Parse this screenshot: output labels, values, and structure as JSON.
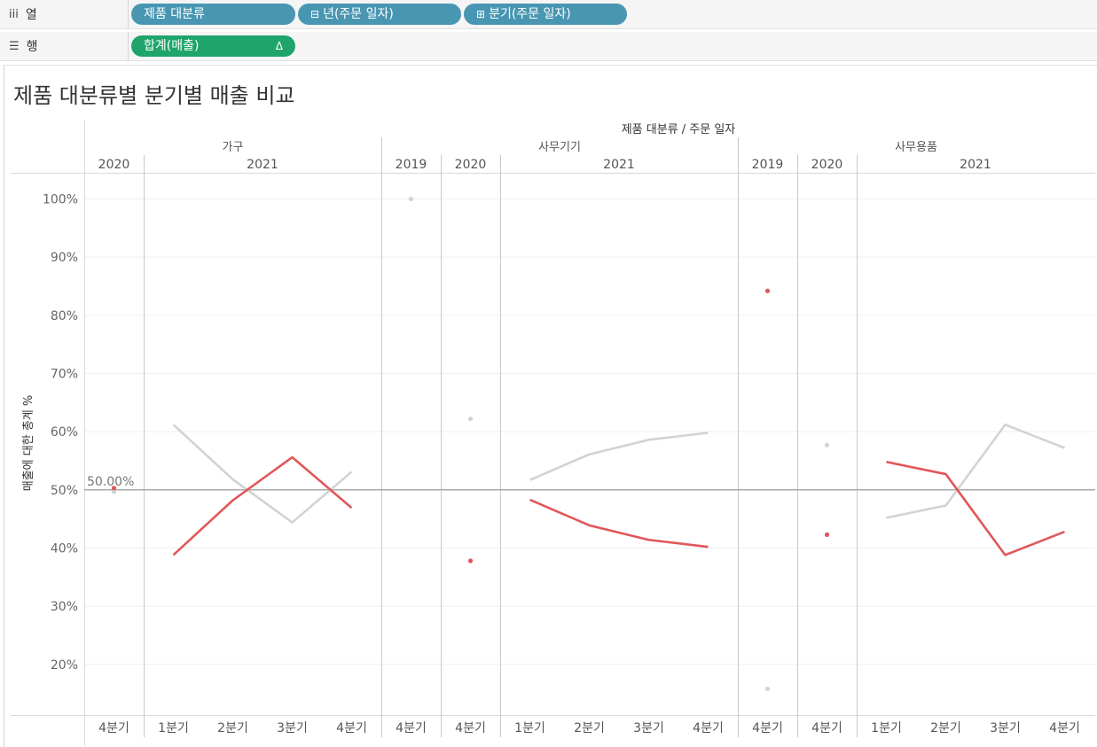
{
  "shelves": {
    "columns": {
      "label": "열",
      "icon": "columns-icon",
      "pills": [
        {
          "label": "제품 대분류",
          "prefix": ""
        },
        {
          "label": "년(주문 일자)",
          "prefix": "⊟"
        },
        {
          "label": "분기(주문 일자)",
          "prefix": "⊞"
        }
      ]
    },
    "rows": {
      "label": "행",
      "icon": "rows-icon",
      "pills": [
        {
          "label": "합계(매출)",
          "delta": "Δ"
        }
      ]
    }
  },
  "colors": {
    "pill_dimension": "#4996b2",
    "pill_measure": "#1fa56b",
    "series_red": "#e15759",
    "series_gray": "#d3d3d3",
    "reference": "#aaaaaa"
  },
  "chart_data": {
    "type": "line",
    "title": "제품 대분류별 분기별 매출 비교",
    "header_title": "제품 대분류 / 주문 일자",
    "ylabel": "매출에 대한 총계 %",
    "ylim": [
      15,
      105
    ],
    "yticks": [
      "20%",
      "30%",
      "40%",
      "50%",
      "60%",
      "70%",
      "80%",
      "90%",
      "100%"
    ],
    "ytick_values": [
      20,
      30,
      40,
      50,
      60,
      70,
      80,
      90,
      100
    ],
    "reference_line": {
      "value": 50,
      "label": "50.00%"
    },
    "grid": true,
    "categories": [
      {
        "name": "가구",
        "years": [
          {
            "year": "2020",
            "quarters": [
              "4분기"
            ]
          },
          {
            "year": "2021",
            "quarters": [
              "1분기",
              "2분기",
              "3분기",
              "4분기"
            ]
          }
        ]
      },
      {
        "name": "사무기기",
        "years": [
          {
            "year": "2019",
            "quarters": [
              "4분기"
            ]
          },
          {
            "year": "2020",
            "quarters": [
              "4분기"
            ]
          },
          {
            "year": "2021",
            "quarters": [
              "1분기",
              "2분기",
              "3분기",
              "4분기"
            ]
          }
        ]
      },
      {
        "name": "사무용품",
        "years": [
          {
            "year": "2019",
            "quarters": [
              "4분기"
            ]
          },
          {
            "year": "2020",
            "quarters": [
              "4분기"
            ]
          },
          {
            "year": "2021",
            "quarters": [
              "1분기",
              "2분기",
              "3분기",
              "4분기"
            ]
          }
        ]
      }
    ],
    "series": [
      {
        "color": "#e15759",
        "values": [
          [
            50.3
          ],
          [
            38.8,
            48.2,
            55.6,
            46.9
          ],
          [
            null
          ],
          [
            37.8
          ],
          [
            48.3,
            43.9,
            41.4,
            40.2
          ],
          [
            84.2
          ],
          [
            42.3
          ],
          [
            54.8,
            52.7,
            38.8,
            42.8
          ]
        ]
      },
      {
        "color": "#d3d3d3",
        "values": [
          [
            49.7
          ],
          [
            61.2,
            51.8,
            44.4,
            53.1
          ],
          [
            100
          ],
          [
            62.2
          ],
          [
            51.7,
            56.1,
            58.6,
            59.8
          ],
          [
            15.8
          ],
          [
            57.7
          ],
          [
            45.2,
            47.3,
            61.2,
            57.2
          ]
        ]
      }
    ]
  }
}
